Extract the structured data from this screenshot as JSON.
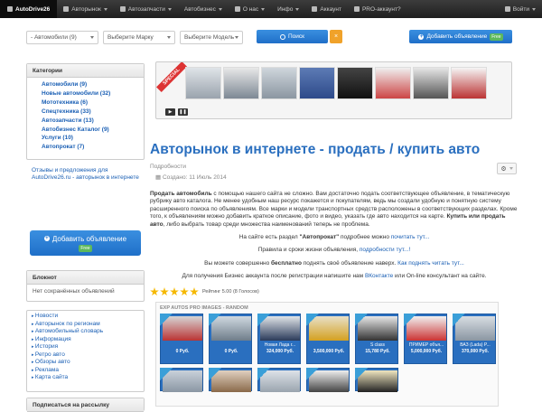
{
  "navbar": {
    "brand": "AutoDrive26",
    "items": [
      "Авторынок",
      "Автозапчасти",
      "Автобизнес",
      "О нас",
      "Инфо",
      "Аккаунт",
      "PRO-аккаунт?"
    ],
    "user": "Войти"
  },
  "search": {
    "select1": "- Автомобили (9)",
    "select2": "Выберите Марку",
    "select3": "Выберите Модель",
    "search_button": "Поиск",
    "clear_button": "×",
    "add_button": "Добавить объявление",
    "free_badge": "Free"
  },
  "sidebar": {
    "categories_title": "Категории",
    "categories": [
      "Автомобили (9)",
      "Новые автомобили (32)",
      "Мототехника (6)",
      "Спецтехника (33)",
      "Автозапчасти (13)",
      "Автобизнес Каталог (9)",
      "Услуги (10)",
      "Автопрокат (7)"
    ],
    "promo_text": "Отзывы и предложения для AutoDrive26.ru - авторынок в интернете",
    "add_button": "Добавить объявление",
    "add_free": "Free",
    "notepad_title": "Блокнот",
    "notepad_text": "Нет сохранённых объявлений",
    "links": [
      "Новости",
      "Авторынок по регионам",
      "Автомобильный словарь",
      "Информация",
      "История",
      "Ретро авто",
      "Обзоры авто",
      "Реклама",
      "Карта сайта"
    ],
    "subscribe_title": "Подписаться на рассылку"
  },
  "slider": {
    "ribbon": "SPECIAL"
  },
  "article": {
    "title": "Авторынок в интернете - продать / купить авто",
    "subcategory": "Подробности",
    "created": "Создано: 11 Июль 2014",
    "p1_bold1": "Продать автомобиль",
    "p1_text1": " с помощью нашего сайта не сложно. Вам достаточно подать соответствующее объявление, в тематическую рубрику авто каталога. Не менее удобным наш ресурс покажется и покупателям, ведь мы создали удобную и понятную систему расширенного поиска по объявлениям. Все марки и модели транспортных средств расположены в соответствующих разделах. Кроме того, к объявлениям можно добавить краткое описание, фото и видео, указать где авто находится на карте. ",
    "p1_bold2": "Купить или продать авто",
    "p1_text2": ", либо выбрать товар среди множества наименований теперь не проблема.",
    "line2_a": "На сайте есть раздел ",
    "line2_bold": "\"Автопрокат\"",
    "line2_b": " подробнее можно ",
    "line2_link": "почитать тут...",
    "line3_a": "Правила и сроки жизни объявления, ",
    "line3_link": "подробности тут...!",
    "line4_a": "Вы можете совершенно ",
    "line4_bold": "бесплатно",
    "line4_b": " поднять своё объявление наверх. ",
    "line4_link": "Как поднять читать тут...",
    "line5_a": "Для получения Бизнес аккаунта после регистрации напишите нам ",
    "line5_link": "ВКонтакте",
    "line5_b": " или On-line консультант на сайте.",
    "rating": "Рейтинг 5.00 (8 Голосов)"
  },
  "gallery": {
    "title": "EXP AUTOS PRO IMAGES - RANDOM",
    "cards": [
      {
        "caption": "",
        "price": "0 Руб."
      },
      {
        "caption": "",
        "price": "0 Руб."
      },
      {
        "caption": "Новая Лада г...",
        "price": "324,000 Руб."
      },
      {
        "caption": "",
        "price": "3,500,000 Руб."
      },
      {
        "caption": "S class",
        "price": "15,780 Руб."
      },
      {
        "caption": "ПРИМЕР объя...",
        "price": "5,000,000 Руб."
      },
      {
        "caption": "ВАЗ (Lada) P...",
        "price": "370,000 Руб."
      }
    ]
  }
}
